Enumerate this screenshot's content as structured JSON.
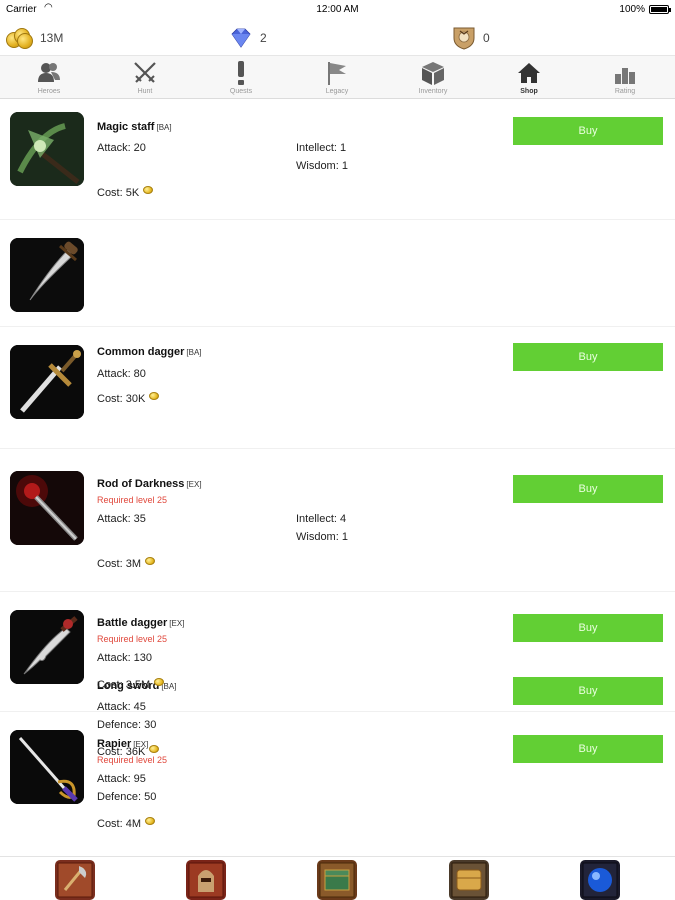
{
  "status_bar": {
    "carrier": "Carrier",
    "time": "12:00 AM",
    "battery": "100%"
  },
  "resources": {
    "gold": "13M",
    "gems": "2",
    "badges": "0"
  },
  "tabs": [
    {
      "label": "Heroes",
      "icon": "heroes-icon"
    },
    {
      "label": "Hunt",
      "icon": "crossed-swords-icon"
    },
    {
      "label": "Quests",
      "icon": "exclamation-icon"
    },
    {
      "label": "Legacy",
      "icon": "flag-icon"
    },
    {
      "label": "Inventory",
      "icon": "box-icon"
    },
    {
      "label": "Shop",
      "icon": "house-icon",
      "active": true
    },
    {
      "label": "Rating",
      "icon": "bar-chart-icon"
    }
  ],
  "shop": {
    "buy_label": "Buy",
    "accent": "#62cf34",
    "required_color": "#e0483c",
    "items": [
      {
        "name": "Magic staff",
        "grade": "[BA]",
        "required": "",
        "stats_left": [
          "Attack: 20"
        ],
        "stats_right": [
          "Intellect: 1",
          "Wisdom: 1"
        ],
        "cost": "Cost: 5K"
      },
      {
        "name": "Common dagger",
        "grade": "[BA]",
        "required": "",
        "stats_left": [
          "Attack: 80"
        ],
        "stats_right": [],
        "cost": "Cost: 30K"
      },
      {
        "name": "Long sword",
        "grade": "[BA]",
        "required": "",
        "stats_left": [
          "Attack: 45",
          "Defence: 30"
        ],
        "stats_right": [],
        "cost": "Cost: 36K"
      },
      {
        "name": "Rod of Darkness",
        "grade": "[EX]",
        "required": "Required level 25",
        "stats_left": [
          "Attack: 35"
        ],
        "stats_right": [
          "Intellect: 4",
          "Wisdom: 1"
        ],
        "cost": "Cost: 3M"
      },
      {
        "name": "Battle dagger",
        "grade": "[EX]",
        "required": "Required level 25",
        "stats_left": [
          "Attack: 130"
        ],
        "stats_right": [],
        "cost": "Cost: 3.5M"
      },
      {
        "name": "Rapier",
        "grade": "[EX]",
        "required": "Required level 25",
        "stats_left": [
          "Attack: 95",
          "Defence: 50"
        ],
        "stats_right": [],
        "cost": "Cost: 4M"
      }
    ]
  },
  "bottom_bar": [
    "axe-tool-icon",
    "warrior-helmet-icon",
    "treasure-chest-icon",
    "scroll-chest-icon",
    "sapphire-gem-icon"
  ]
}
